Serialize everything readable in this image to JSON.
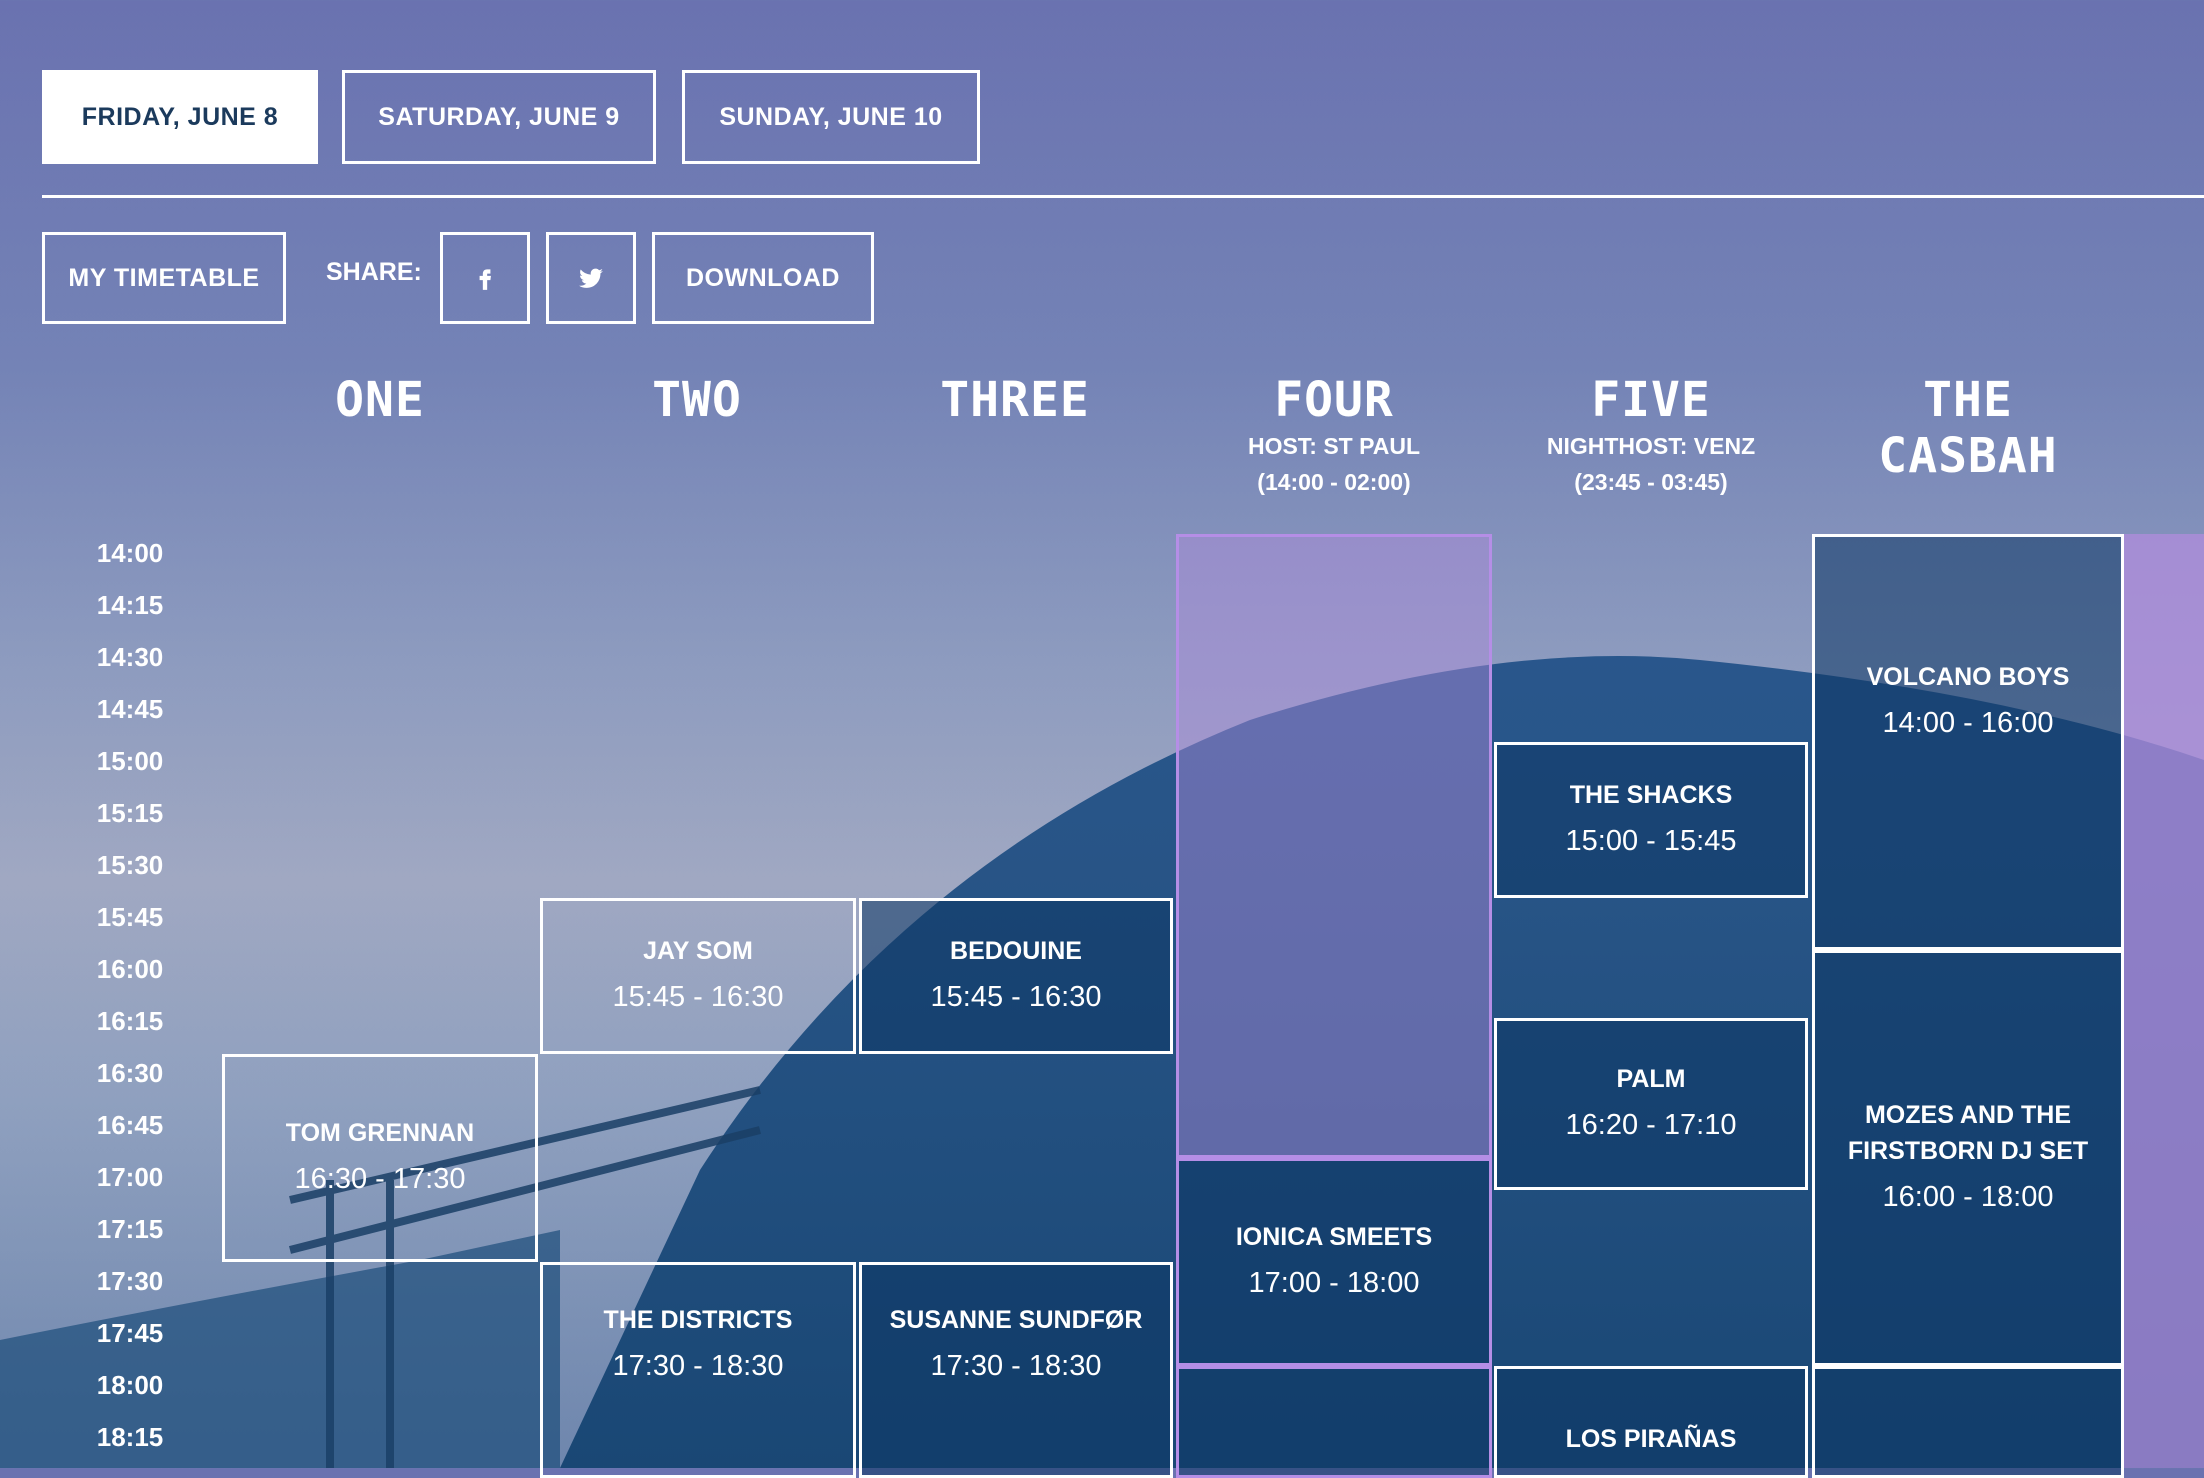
{
  "days": [
    {
      "label": "FRIDAY, JUNE 8",
      "active": true
    },
    {
      "label": "SATURDAY, JUNE 9",
      "active": false
    },
    {
      "label": "SUNDAY, JUNE 10",
      "active": false
    }
  ],
  "toolbar": {
    "my_timetable": "MY TIMETABLE",
    "share_label": "SHARE:",
    "facebook_icon": "facebook-icon",
    "twitter_icon": "twitter-icon",
    "download": "DOWNLOAD"
  },
  "stages": [
    {
      "name": "ONE",
      "host": "",
      "hours": ""
    },
    {
      "name": "TWO",
      "host": "",
      "hours": ""
    },
    {
      "name": "THREE",
      "host": "",
      "hours": ""
    },
    {
      "name": "FOUR",
      "host": "HOST: ST PAUL",
      "hours": "(14:00 - 02:00)"
    },
    {
      "name": "FIVE",
      "host": "NIGHTHOST: VENZ",
      "hours": "(23:45 - 03:45)"
    },
    {
      "name": "THE CASBAH",
      "host": "",
      "hours": ""
    }
  ],
  "times": [
    "14:00",
    "14:15",
    "14:30",
    "14:45",
    "15:00",
    "15:15",
    "15:30",
    "15:45",
    "16:00",
    "16:15",
    "16:30",
    "16:45",
    "17:00",
    "17:15",
    "17:30",
    "17:45",
    "18:00",
    "18:15"
  ],
  "slots": [
    {
      "name": "TOM GRENNAN",
      "time": "16:30 - 17:30"
    },
    {
      "name": "JAY SOM",
      "time": "15:45 - 16:30"
    },
    {
      "name": "THE DISTRICTS",
      "time": "17:30 - 18:30"
    },
    {
      "name": "BEDOUINE",
      "time": "15:45 - 16:30"
    },
    {
      "name": "SUSANNE SUNDFØR",
      "time": "17:30 - 18:30"
    },
    {
      "name": "IONICA SMEETS",
      "time": "17:00 - 18:00"
    },
    {
      "name": "THE SHACKS",
      "time": "15:00 - 15:45"
    },
    {
      "name": "PALM",
      "time": "16:20 - 17:10"
    },
    {
      "name": "LOS PIRAÑAS",
      "time": ""
    },
    {
      "name": "VOLCANO BOYS",
      "time": "14:00 - 16:00"
    },
    {
      "name": "MOZES AND THE FIRSTBORN DJ SET",
      "time": "16:00 - 18:00"
    }
  ],
  "colors": {
    "accent_purple": "#b58ee6",
    "active_day_text": "#1b3a5c",
    "block_dark": "#0d3764"
  }
}
